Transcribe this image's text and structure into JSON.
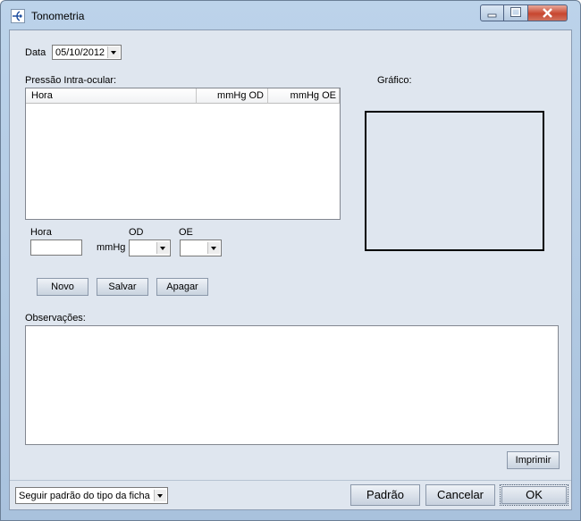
{
  "window": {
    "title": "Tonometria"
  },
  "date": {
    "label": "Data",
    "value": "05/10/2012"
  },
  "pressure": {
    "label": "Pressão Intra-ocular:",
    "columns": [
      "Hora",
      "mmHg OD",
      "mmHg OE"
    ],
    "rows": []
  },
  "entry": {
    "hora_label": "Hora",
    "hora_value": "",
    "unit_label": "mmHg",
    "od_label": "OD",
    "od_value": "",
    "oe_label": "OE",
    "oe_value": ""
  },
  "actions": {
    "novo": "Novo",
    "salvar": "Salvar",
    "apagar": "Apagar"
  },
  "graph": {
    "label": "Gráfico:"
  },
  "observations": {
    "label": "Observações:",
    "value": ""
  },
  "print": {
    "label": "Imprimir"
  },
  "footer": {
    "mode_select": "Seguir padrão do tipo da ficha",
    "padrao": "Padrão",
    "cancelar": "Cancelar",
    "ok": "OK"
  },
  "icons": [
    "app-icon",
    "minimize-icon",
    "maximize-icon",
    "close-icon",
    "chevron-down-icon"
  ]
}
